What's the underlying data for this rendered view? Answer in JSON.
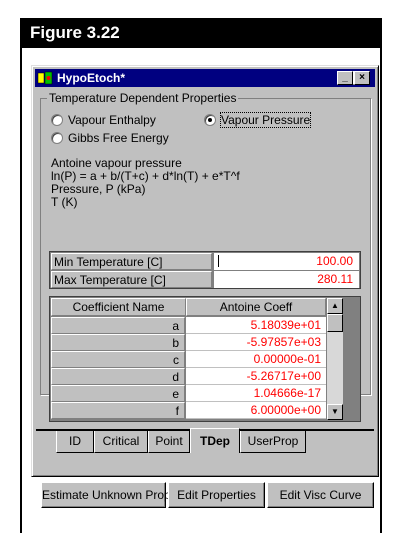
{
  "figure_label": "Figure 3.22",
  "window": {
    "title": "HypoEtoch*",
    "minimize_glyph": "_",
    "maximize_glyph": "□",
    "close_glyph": "×"
  },
  "group": {
    "title": "Temperature Dependent Properties",
    "radio_vapour_enthalpy": "Vapour Enthalpy",
    "radio_vapour_pressure": "Vapour Pressure",
    "radio_gibbs": "Gibbs Free Energy",
    "selected": "Vapour Pressure"
  },
  "description": {
    "line1": "Antoine vapour pressure",
    "line2": "ln(P) = a + b/(T+c) + d*ln(T) + e*T^f",
    "line3": "Pressure, P (kPa)",
    "line4": "T (K)"
  },
  "temps": {
    "min_label": "Min Temperature [C]",
    "min_value": "100.00",
    "max_label": "Max Temperature [C]",
    "max_value": "280.11"
  },
  "coeff_table": {
    "header_name": "Coefficient Name",
    "header_value": "Antoine Coeff",
    "rows": [
      {
        "name": "a",
        "value": "5.18039e+01"
      },
      {
        "name": "b",
        "value": "-5.97857e+03"
      },
      {
        "name": "c",
        "value": "0.00000e-01"
      },
      {
        "name": "d",
        "value": "-5.26717e+00"
      },
      {
        "name": "e",
        "value": "1.04666e-17"
      },
      {
        "name": "f",
        "value": "6.00000e+00"
      }
    ]
  },
  "tabs": {
    "id": "ID",
    "critical": "Critical",
    "point": "Point",
    "tdep": "TDep",
    "userprop": "UserProp",
    "active": "TDep"
  },
  "buttons": {
    "estimate": "Estimate Unknown Props",
    "edit_properties": "Edit Properties",
    "edit_visc": "Edit Visc Curve"
  },
  "colors": {
    "title_bar": "#000080",
    "value_text": "#ff0000",
    "face": "#c0c0c0"
  }
}
